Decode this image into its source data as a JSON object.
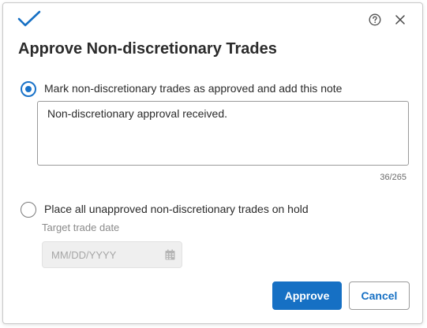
{
  "dialog": {
    "title": "Approve Non-discretionary Trades",
    "icons": {
      "header": "checkmark-icon",
      "help": "help-icon",
      "close": "close-icon",
      "date": "calendar-icon"
    },
    "accent_color": "#1670c4"
  },
  "option_approve": {
    "label": "Mark non-discretionary trades as approved and add this note",
    "selected": true,
    "note_value": "Non-discretionary approval received.",
    "char_count": "36/265"
  },
  "option_hold": {
    "label": "Place all unapproved non-discretionary trades on hold",
    "selected": false,
    "target_date_label": "Target trade date",
    "date_placeholder": "MM/DD/YYYY"
  },
  "actions": {
    "approve_label": "Approve",
    "cancel_label": "Cancel"
  }
}
